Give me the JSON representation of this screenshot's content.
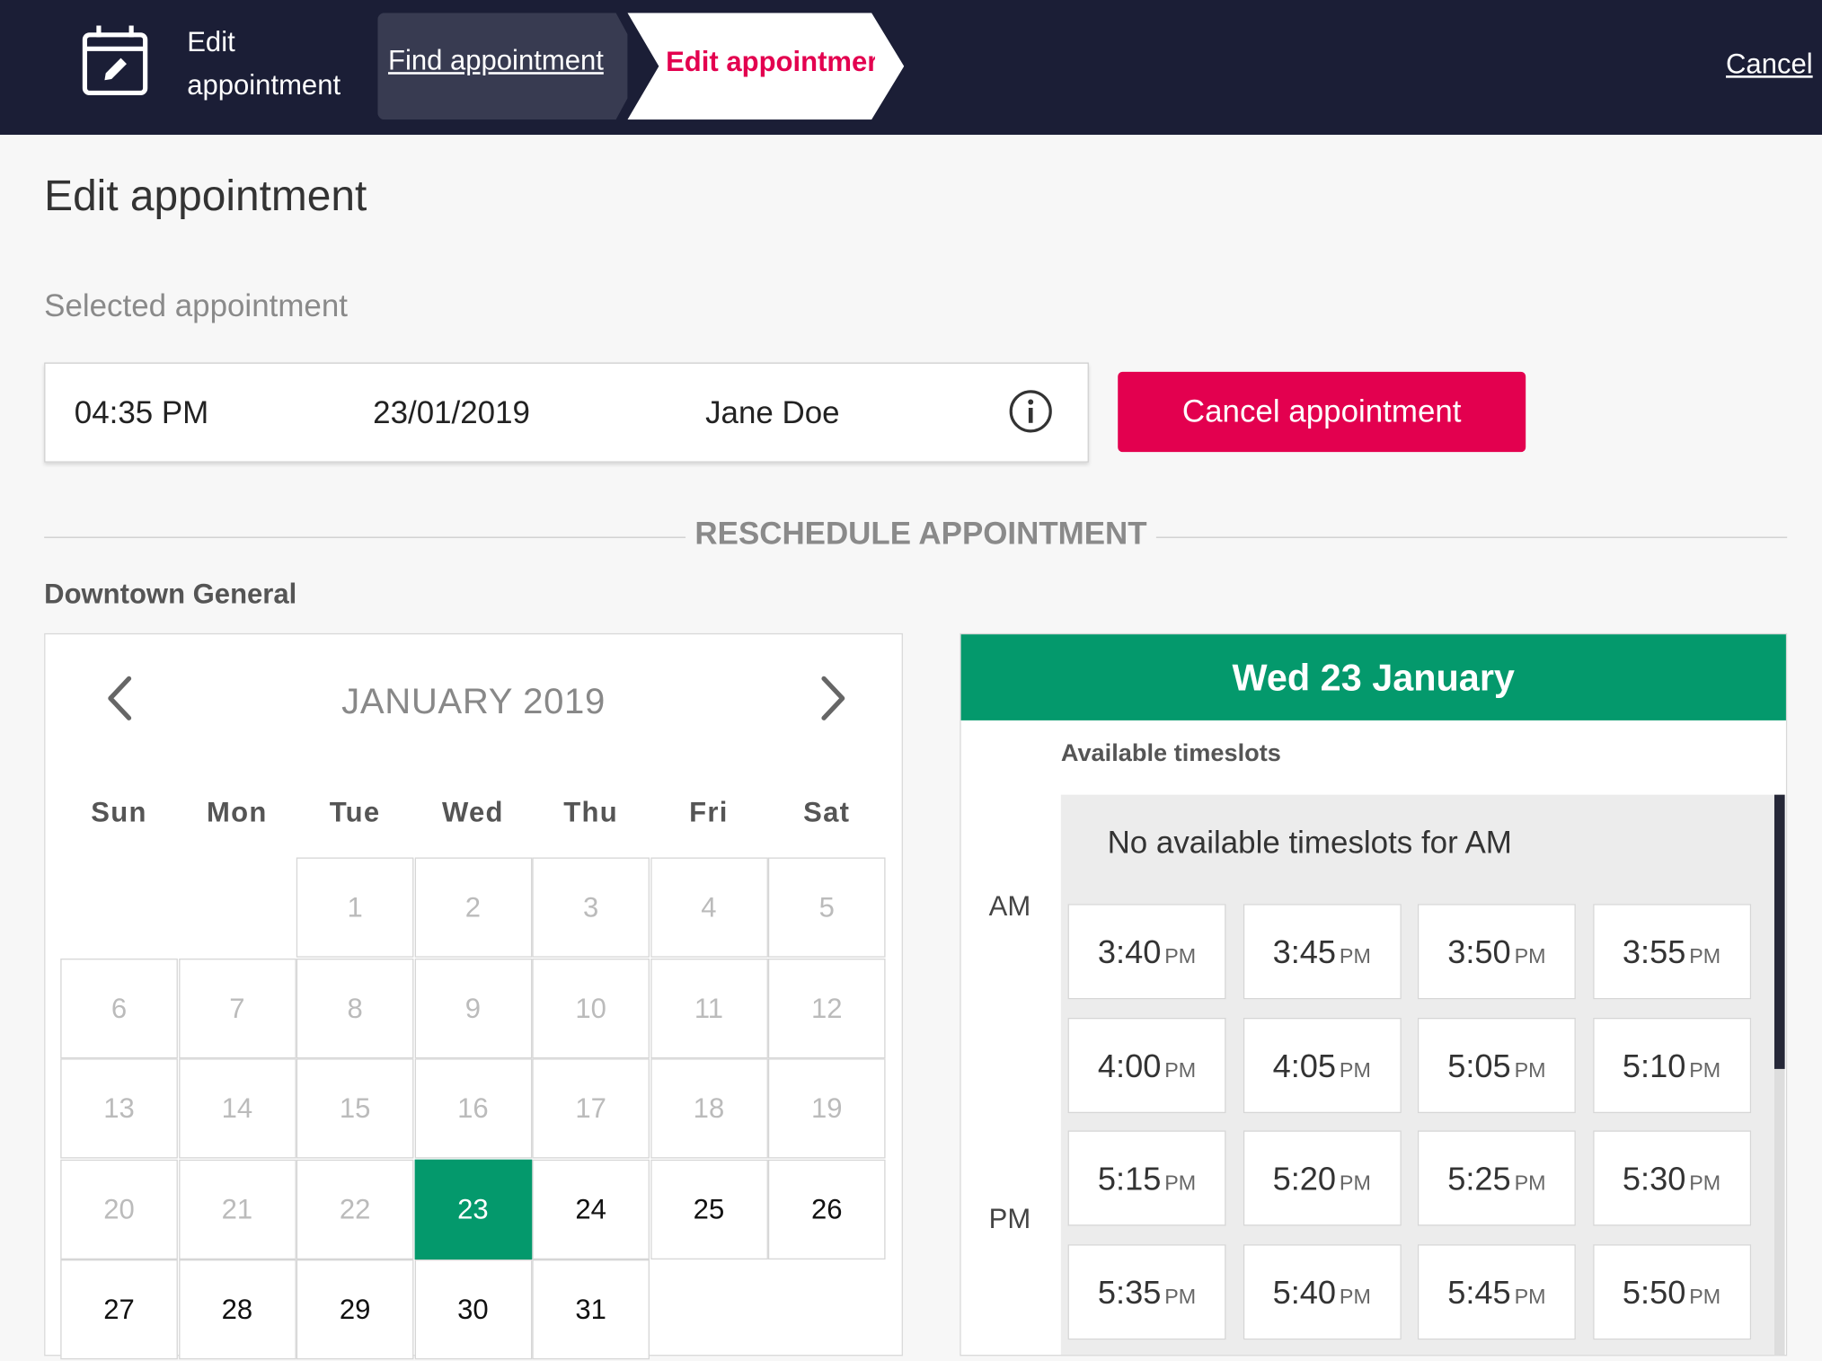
{
  "header": {
    "app_title": "Edit appointment",
    "breadcrumb": [
      "Find appointment",
      "Edit appointmer"
    ],
    "cancel_label": "Cancel"
  },
  "page_title": "Edit appointment",
  "selected_section_label": "Selected appointment",
  "appointment": {
    "time": "04:35 PM",
    "date": "23/01/2019",
    "name": "Jane Doe"
  },
  "cancel_appointment_label": "Cancel appointment",
  "reschedule_label": "RESCHEDULE APPOINTMENT",
  "location": "Downtown General",
  "calendar": {
    "month_label": "JANUARY 2019",
    "weekdays": [
      "Sun",
      "Mon",
      "Tue",
      "Wed",
      "Thu",
      "Fri",
      "Sat"
    ],
    "days_in_month": 31,
    "first_weekday_index": 2,
    "selected_day": 23,
    "first_active_day": 23
  },
  "timeslots": {
    "header": "Wed 23 January",
    "available_label": "Available timeslots",
    "am_label": "AM",
    "pm_label": "PM",
    "no_am": "No available timeslots for AM",
    "pm_suffix": "PM",
    "pm_slots": [
      "3:40",
      "3:45",
      "3:50",
      "3:55",
      "4:00",
      "4:05",
      "5:05",
      "5:10",
      "5:15",
      "5:20",
      "5:25",
      "5:30",
      "5:35",
      "5:40",
      "5:45",
      "5:50"
    ]
  },
  "colors": {
    "brand_dark": "#1b1e36",
    "accent_red": "#e3004f",
    "accent_green": "#04996c"
  },
  "icons": [
    "calendar-edit-icon",
    "info-icon",
    "chevron-left-icon",
    "chevron-right-icon"
  ]
}
